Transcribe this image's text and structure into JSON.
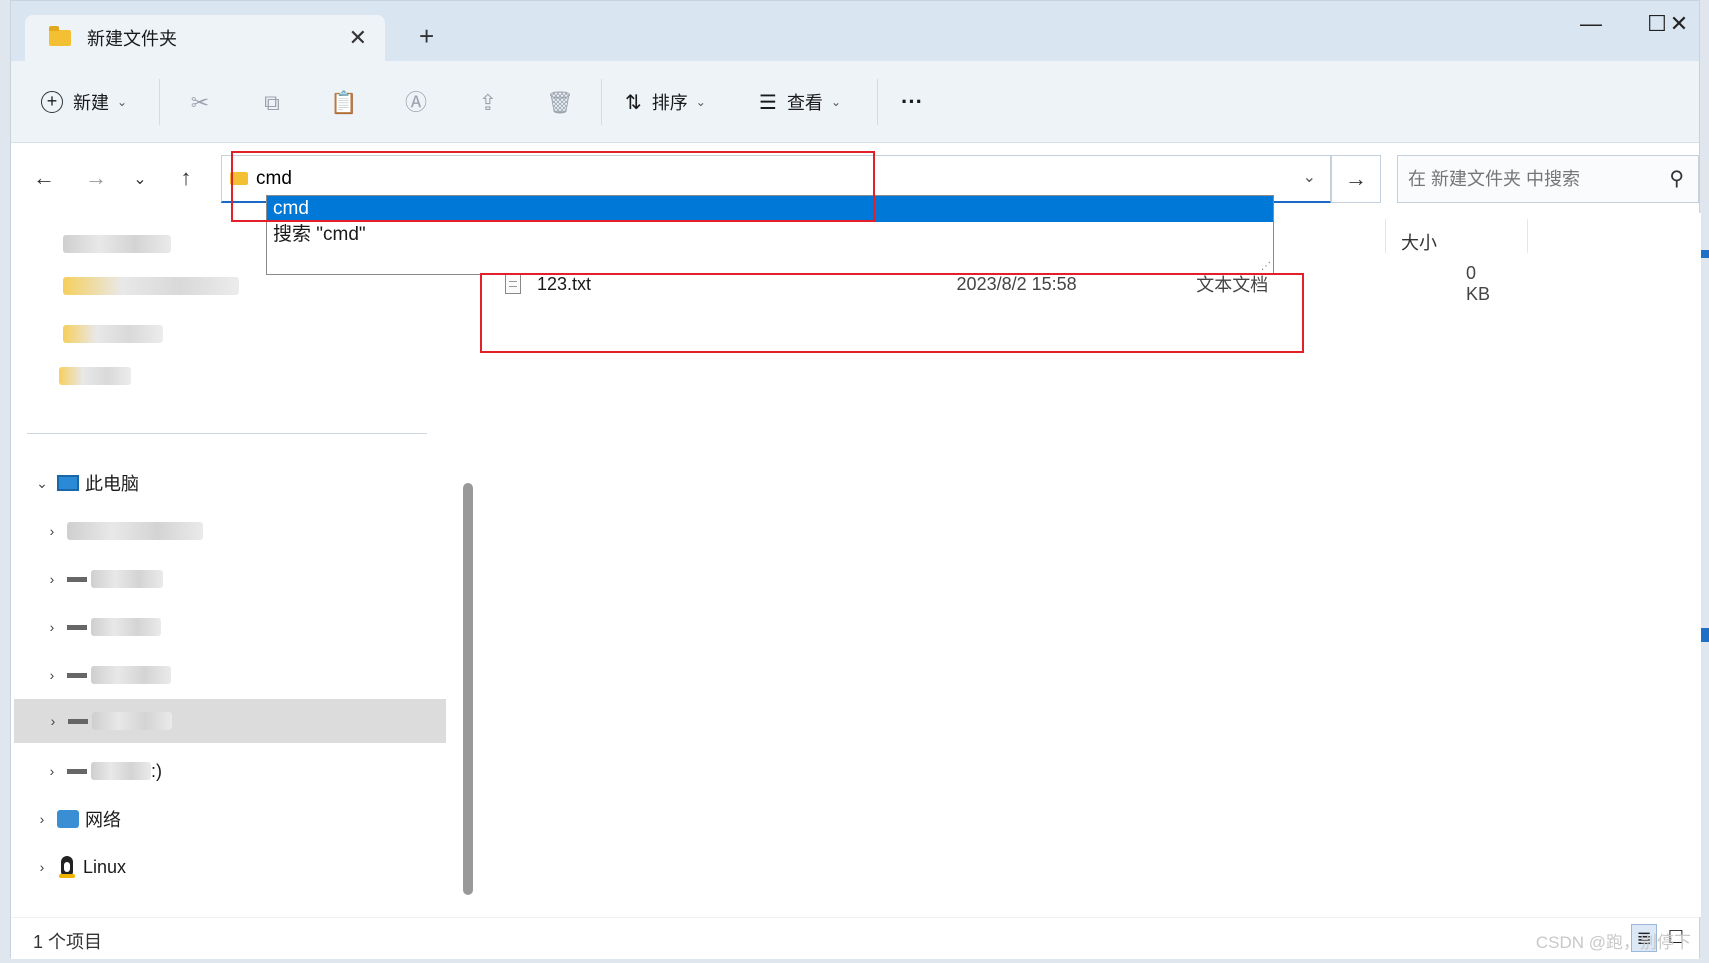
{
  "window": {
    "tab_title": "新建文件夹",
    "new_tab_label": "+",
    "close_tab_label": "✕",
    "minimize_label": "—",
    "maximize_label": "☐",
    "close_label": "✕"
  },
  "toolbar": {
    "new_label": "新建",
    "sort_label": "排序",
    "view_label": "查看",
    "more_label": "···"
  },
  "address": {
    "value": "cmd",
    "search_placeholder": "在 新建文件夹 中搜索"
  },
  "autocomplete": {
    "items": [
      "cmd",
      "搜索 \"cmd\""
    ]
  },
  "sidebar": {
    "this_pc": "此电脑",
    "network": "网络",
    "linux": "Linux",
    "drive_partial_label": ":)"
  },
  "columns": {
    "size": "大小"
  },
  "files": [
    {
      "name": "123.txt",
      "date": "2023/8/2 15:58",
      "type": "文本文档",
      "size": "0 KB"
    }
  ],
  "status": {
    "count_text": "1 个项目"
  },
  "watermark": "CSDN @跑，别停下",
  "colors": {
    "accent": "#0078d7",
    "highlight_box": "#e3202a",
    "title_bar": "#d9e5f0"
  }
}
